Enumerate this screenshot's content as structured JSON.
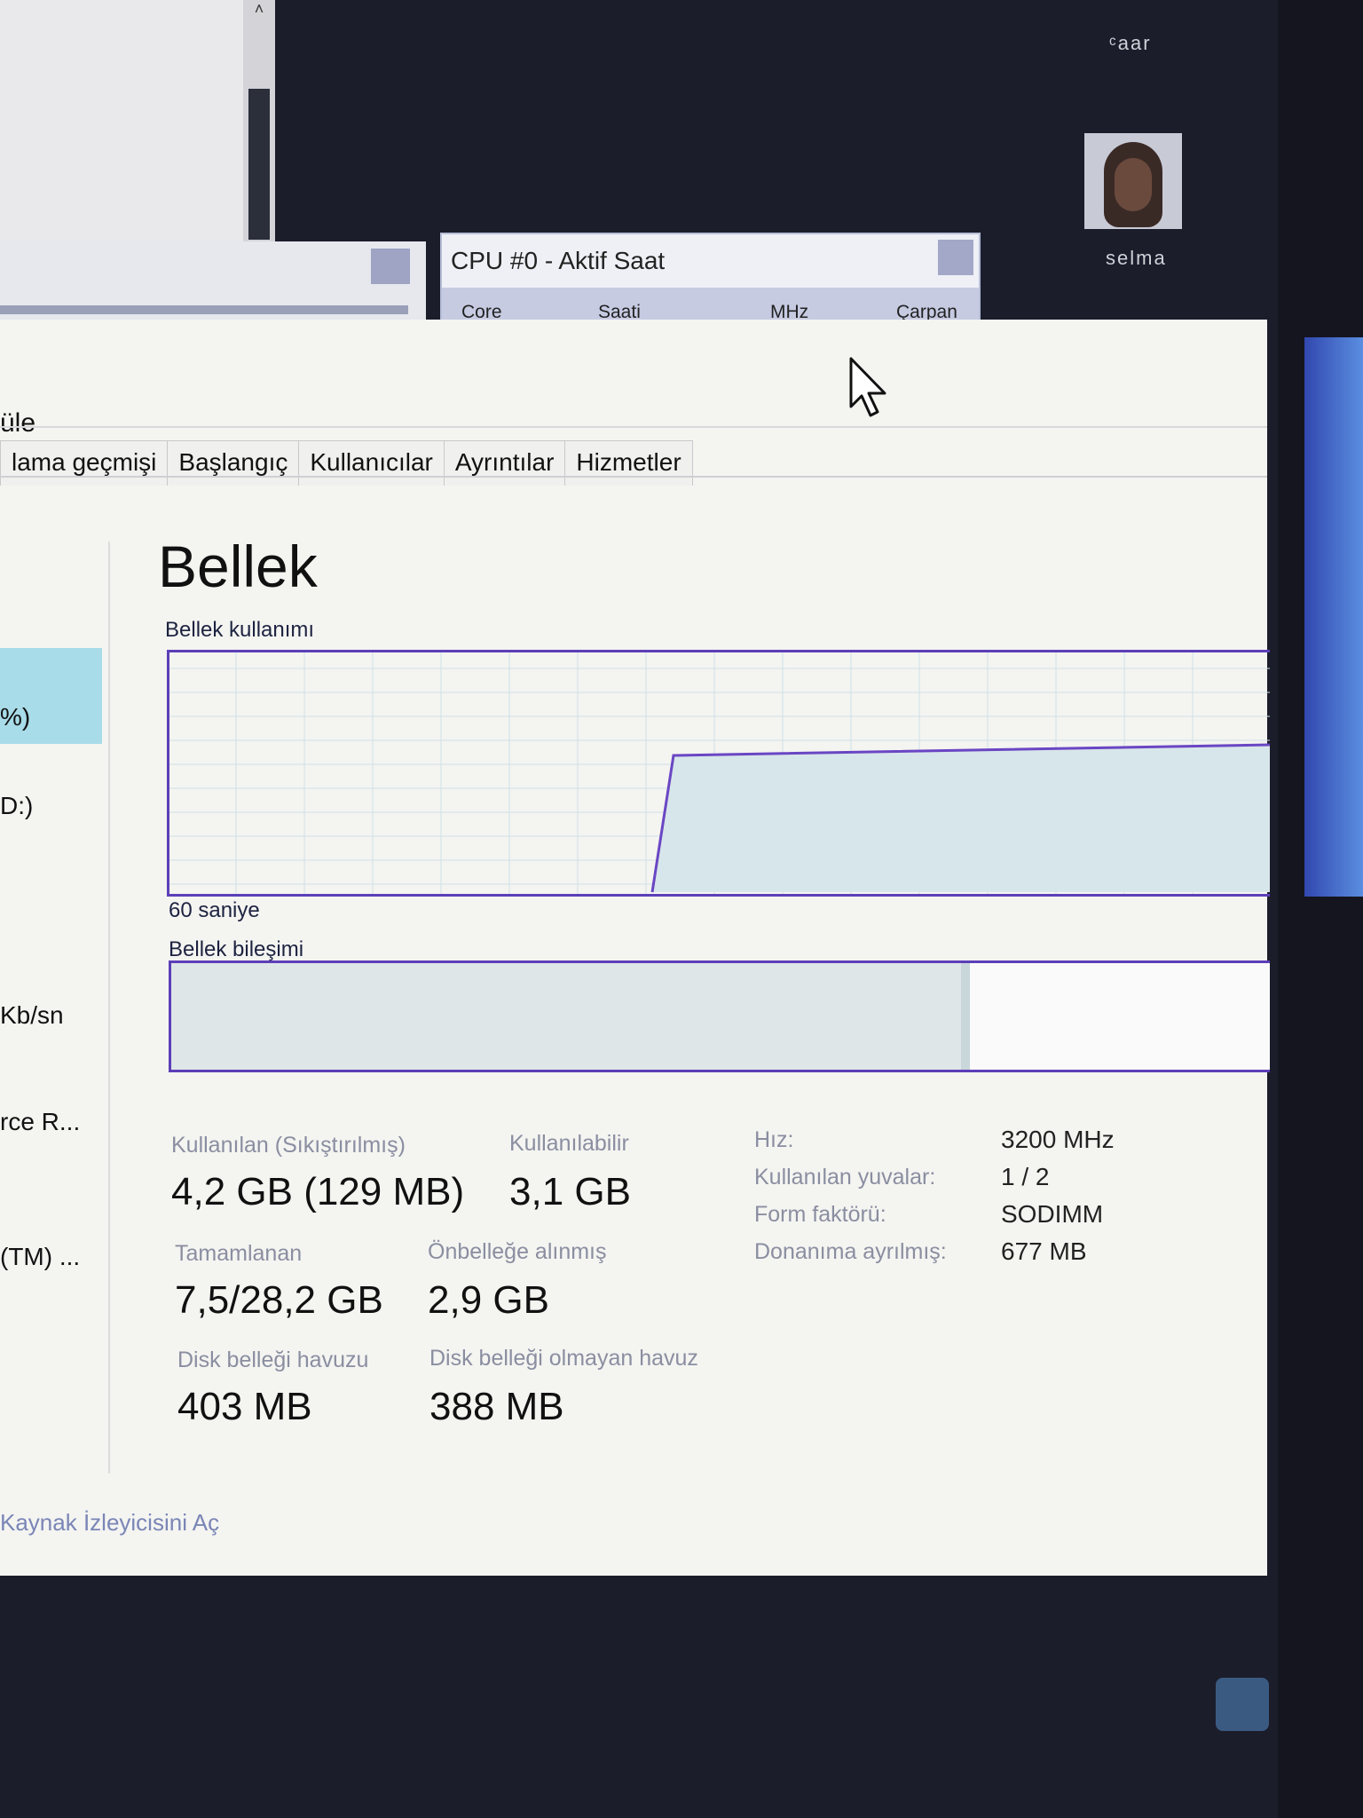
{
  "cpu_window": {
    "title": "CPU #0 - Aktif Saat",
    "columns": [
      "Core",
      "Saati",
      "MHz",
      "Çarpan"
    ]
  },
  "avatars": {
    "top_label": "ᶜaar",
    "user_name": "selma"
  },
  "task_manager": {
    "title_fragment": "üle",
    "tabs": [
      "lama geçmişi",
      "Başlangıç",
      "Kullanıcılar",
      "Ayrıntılar",
      "Hizmetler"
    ],
    "sidebar": [
      "%)",
      "D:)",
      "Kb/sn",
      "rce R...",
      "(TM) ..."
    ],
    "heading": "Bellek",
    "usage_label": "Bellek kullanımı",
    "time_label": "60 saniye",
    "composition_label": "Bellek bileşimi",
    "stats": {
      "used_label": "Kullanılan (Sıkıştırılmış)",
      "used_value": "4,2 GB (129 MB)",
      "available_label": "Kullanılabilir",
      "available_value": "3,1 GB",
      "committed_label": "Tamamlanan",
      "committed_value": "7,5/28,2 GB",
      "cached_label": "Önbelleğe alınmış",
      "cached_value": "2,9 GB",
      "paged_label": "Disk belleği havuzu",
      "paged_value": "403 MB",
      "nonpaged_label": "Disk belleği olmayan havuz",
      "nonpaged_value": "388 MB"
    },
    "specs": [
      {
        "label": "Hız:",
        "value": "3200 MHz"
      },
      {
        "label": "Kullanılan yuvalar:",
        "value": "1 / 2"
      },
      {
        "label": "Form faktörü:",
        "value": "SODIMM"
      },
      {
        "label": "Donanıma ayrılmış:",
        "value": "677 MB"
      }
    ],
    "footer_link": "Kaynak İzleyicisini Aç"
  }
}
